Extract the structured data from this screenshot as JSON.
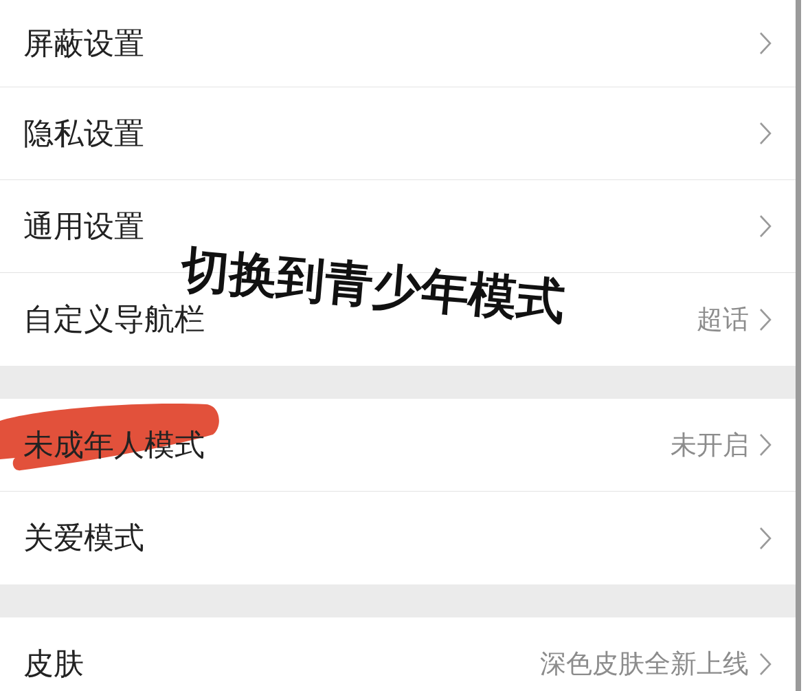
{
  "groups": [
    {
      "items": [
        {
          "label": "屏蔽设置",
          "highlighted": false
        },
        {
          "label": "隐私设置",
          "highlighted": false
        },
        {
          "label": "通用设置",
          "highlighted": false
        },
        {
          "label": "自定义导航栏",
          "value": "超话",
          "highlighted": false
        }
      ]
    },
    {
      "items": [
        {
          "label": "未成年人模式",
          "value": "未开启",
          "highlighted": true
        },
        {
          "label": "关爱模式",
          "highlighted": false
        }
      ]
    },
    {
      "items": [
        {
          "label": "皮肤",
          "value": "深色皮肤全新上线",
          "highlighted": false
        }
      ]
    }
  ],
  "annotation": {
    "text": "切换到青少年模式"
  }
}
